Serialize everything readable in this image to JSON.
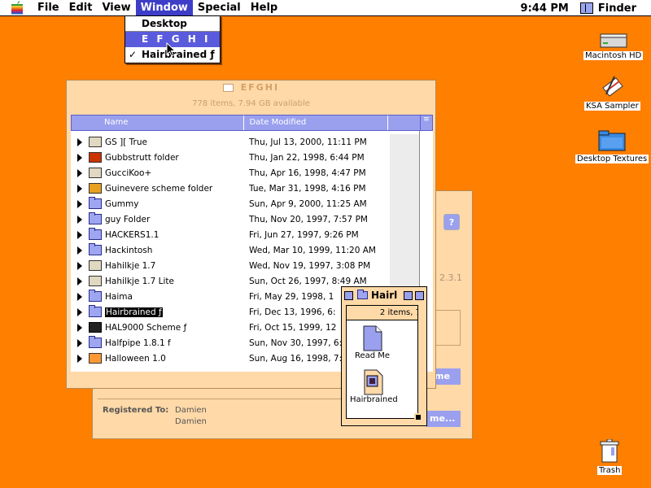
{
  "menubar": {
    "menus": [
      "File",
      "Edit",
      "View",
      "Window",
      "Special",
      "Help"
    ],
    "active_menu": "Window",
    "clock": "9:44 PM",
    "app": "Finder"
  },
  "window_menu": {
    "items": [
      "Desktop",
      "E F G H I",
      "Hairbrained ƒ"
    ]
  },
  "desktop_icons": {
    "hd": "Macintosh HD",
    "ksa": "KSA Sampler",
    "textures": "Desktop Textures",
    "trash": "Trash"
  },
  "main_window": {
    "title": "EFGHI",
    "info": "778 items, 7.94 GB available",
    "columns": {
      "name": "Name",
      "date": "Date Modified"
    },
    "rows": [
      {
        "name": "GS ][ True",
        "date": "Thu, Jul 13, 2000, 11:11 PM"
      },
      {
        "name": "Gubbstrutt folder",
        "date": "Thu, Jan 22, 1998, 6:44 PM"
      },
      {
        "name": "GucciKoo+",
        "date": "Thu, Apr 16, 1998, 4:47 PM"
      },
      {
        "name": "Guinevere scheme folder",
        "date": "Tue, Mar 31, 1998, 4:16 PM"
      },
      {
        "name": "Gummy",
        "date": "Sun, Apr 9, 2000, 11:25 AM"
      },
      {
        "name": "guy Folder",
        "date": "Thu, Nov 20, 1997, 7:57 PM"
      },
      {
        "name": "HACKERS1.1",
        "date": "Fri, Jun 27, 1997, 9:26 PM"
      },
      {
        "name": "Hackintosh",
        "date": "Wed, Mar 10, 1999, 11:20 AM"
      },
      {
        "name": "Hahilkje 1.7",
        "date": "Wed, Nov 19, 1997, 3:08 PM"
      },
      {
        "name": "Hahilkje 1.7 Lite",
        "date": "Sun, Oct 26, 1997, 8:49 AM"
      },
      {
        "name": "Haima",
        "date": "Fri, May 29, 1998, 1"
      },
      {
        "name": "Hairbrained ƒ",
        "date": "Fri, Dec 13, 1996, 6:"
      },
      {
        "name": "HAL9000 Scheme ƒ",
        "date": "Fri, Oct 15, 1999, 12"
      },
      {
        "name": "Halfpipe 1.8.1 f",
        "date": "Sun, Nov 30, 1997, 6:"
      },
      {
        "name": "Halloween 1.0",
        "date": "Sun, Aug 16, 1998, 7:"
      }
    ]
  },
  "hairl_window": {
    "title": "Hairl",
    "count": "2 items, 7",
    "items": [
      "Read Me",
      "Hairbrained"
    ]
  },
  "back_window": {
    "version": "2.3.1",
    "registered_label": "Registered To:",
    "registered_name1": "Damien",
    "registered_name2": "Damien",
    "btn1": "me",
    "btn2": "me..."
  },
  "colors": {
    "desktop": "#ff7f00",
    "window_bg": "#ffd9a8",
    "accent": "#9aa0ee",
    "menu_highlight": "#3d3dc8"
  }
}
